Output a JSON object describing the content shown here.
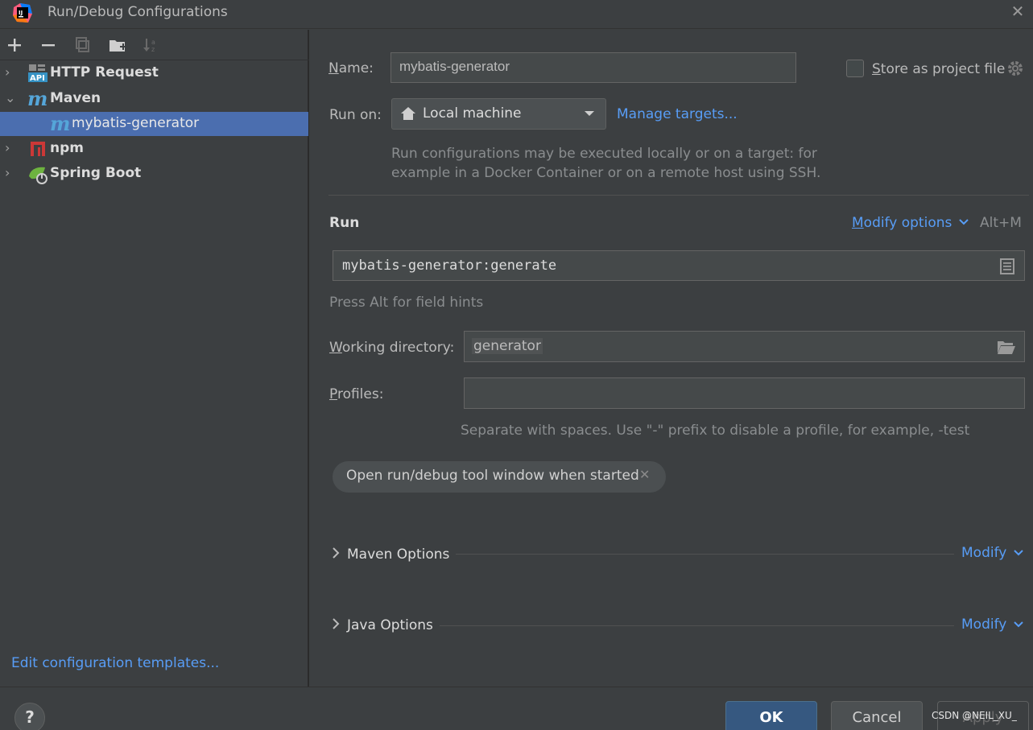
{
  "window": {
    "title": "Run/Debug Configurations"
  },
  "toolbar": {
    "add": "+",
    "remove": "−",
    "copy": "⧉",
    "folder": "▶",
    "sort": "↓"
  },
  "tree": {
    "items": [
      {
        "label": "HTTP Request",
        "icon": "http-request-icon"
      },
      {
        "label": "Maven",
        "icon": "maven-icon"
      },
      {
        "label": "mybatis-generator",
        "icon": "maven-icon"
      },
      {
        "label": "npm",
        "icon": "npm-icon"
      },
      {
        "label": "Spring Boot",
        "icon": "spring-boot-icon"
      }
    ],
    "selected": "mybatis-generator"
  },
  "edit_templates": "Edit configuration templates...",
  "name": {
    "label_u": "N",
    "label_rest": "ame:",
    "value": "mybatis-generator"
  },
  "store": {
    "label_u": "S",
    "label_rest": "tore as project file",
    "checked": false
  },
  "run_on": {
    "label": "Run on:",
    "value": "Local machine",
    "manage": "Manage targets...",
    "hint_line1": "Run configurations may be executed locally or on a target: for",
    "hint_line2": "example in a Docker Container or on a remote host using SSH."
  },
  "run_section": {
    "title": "Run",
    "modify_u": "M",
    "modify_rest": "odify options",
    "shortcut": "Alt+M",
    "command": "mybatis-generator:generate",
    "hint": "Press Alt for field hints"
  },
  "working_dir": {
    "label_u": "W",
    "label_rest": "orking directory:",
    "value": "generator"
  },
  "profiles": {
    "label_u": "P",
    "label_rest": "rofiles:",
    "value": "",
    "hint": "Separate with spaces. Use \"-\" prefix to disable a profile, for example, -test"
  },
  "chip": {
    "label": "Open run/debug tool window when started"
  },
  "maven_options": {
    "title": "Maven Options",
    "modify": "Modify"
  },
  "java_options": {
    "title": "Java Options",
    "modify": "Modify"
  },
  "buttons": {
    "help": "?",
    "ok": "OK",
    "cancel": "Cancel",
    "apply": "Apply"
  },
  "watermark": "CSDN @NEIL_XU_",
  "colors": {
    "background": "#3c3f41",
    "selection": "#4b6eaf",
    "link": "#589df6",
    "ok_button": "#365880"
  }
}
